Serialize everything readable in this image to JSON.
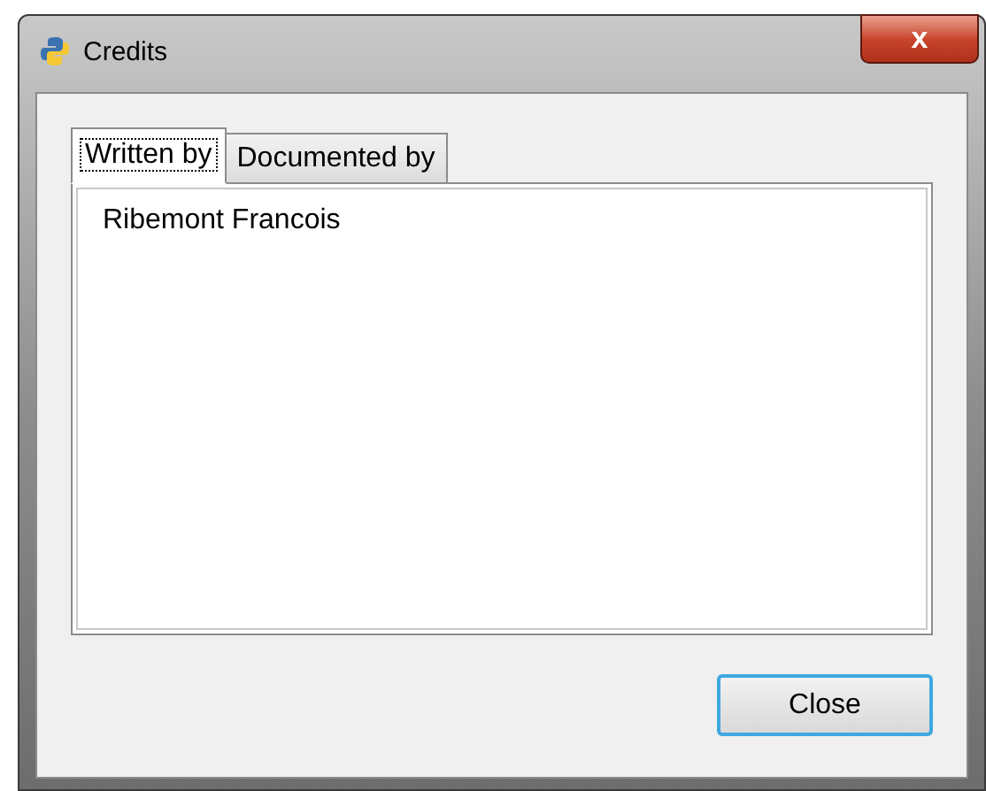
{
  "window": {
    "title": "Credits",
    "close": "x"
  },
  "tabs": [
    {
      "label": "Written by",
      "selected": true
    },
    {
      "label": "Documented by",
      "selected": false
    }
  ],
  "content": [
    "Ribemont Francois"
  ],
  "buttons": [
    "Close"
  ]
}
